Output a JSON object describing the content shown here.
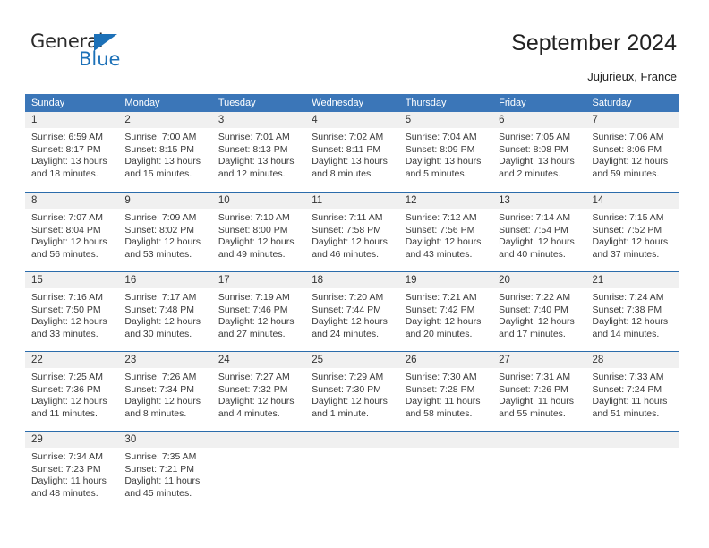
{
  "logo": {
    "word1": "General",
    "word2": "Blue",
    "triangle_color": "#1d71b8"
  },
  "header": {
    "title": "September 2024",
    "subtitle": "Jujurieux, France"
  },
  "theme": {
    "header_blue": "#3b76b8",
    "separator_blue": "#2b6cab",
    "daynum_bg": "#f0f0f0"
  },
  "calendar": {
    "weekdays": [
      "Sunday",
      "Monday",
      "Tuesday",
      "Wednesday",
      "Thursday",
      "Friday",
      "Saturday"
    ],
    "weeks": [
      [
        {
          "day": "1",
          "sunrise": "Sunrise: 6:59 AM",
          "sunset": "Sunset: 8:17 PM",
          "daylight1": "Daylight: 13 hours",
          "daylight2": "and 18 minutes."
        },
        {
          "day": "2",
          "sunrise": "Sunrise: 7:00 AM",
          "sunset": "Sunset: 8:15 PM",
          "daylight1": "Daylight: 13 hours",
          "daylight2": "and 15 minutes."
        },
        {
          "day": "3",
          "sunrise": "Sunrise: 7:01 AM",
          "sunset": "Sunset: 8:13 PM",
          "daylight1": "Daylight: 13 hours",
          "daylight2": "and 12 minutes."
        },
        {
          "day": "4",
          "sunrise": "Sunrise: 7:02 AM",
          "sunset": "Sunset: 8:11 PM",
          "daylight1": "Daylight: 13 hours",
          "daylight2": "and 8 minutes."
        },
        {
          "day": "5",
          "sunrise": "Sunrise: 7:04 AM",
          "sunset": "Sunset: 8:09 PM",
          "daylight1": "Daylight: 13 hours",
          "daylight2": "and 5 minutes."
        },
        {
          "day": "6",
          "sunrise": "Sunrise: 7:05 AM",
          "sunset": "Sunset: 8:08 PM",
          "daylight1": "Daylight: 13 hours",
          "daylight2": "and 2 minutes."
        },
        {
          "day": "7",
          "sunrise": "Sunrise: 7:06 AM",
          "sunset": "Sunset: 8:06 PM",
          "daylight1": "Daylight: 12 hours",
          "daylight2": "and 59 minutes."
        }
      ],
      [
        {
          "day": "8",
          "sunrise": "Sunrise: 7:07 AM",
          "sunset": "Sunset: 8:04 PM",
          "daylight1": "Daylight: 12 hours",
          "daylight2": "and 56 minutes."
        },
        {
          "day": "9",
          "sunrise": "Sunrise: 7:09 AM",
          "sunset": "Sunset: 8:02 PM",
          "daylight1": "Daylight: 12 hours",
          "daylight2": "and 53 minutes."
        },
        {
          "day": "10",
          "sunrise": "Sunrise: 7:10 AM",
          "sunset": "Sunset: 8:00 PM",
          "daylight1": "Daylight: 12 hours",
          "daylight2": "and 49 minutes."
        },
        {
          "day": "11",
          "sunrise": "Sunrise: 7:11 AM",
          "sunset": "Sunset: 7:58 PM",
          "daylight1": "Daylight: 12 hours",
          "daylight2": "and 46 minutes."
        },
        {
          "day": "12",
          "sunrise": "Sunrise: 7:12 AM",
          "sunset": "Sunset: 7:56 PM",
          "daylight1": "Daylight: 12 hours",
          "daylight2": "and 43 minutes."
        },
        {
          "day": "13",
          "sunrise": "Sunrise: 7:14 AM",
          "sunset": "Sunset: 7:54 PM",
          "daylight1": "Daylight: 12 hours",
          "daylight2": "and 40 minutes."
        },
        {
          "day": "14",
          "sunrise": "Sunrise: 7:15 AM",
          "sunset": "Sunset: 7:52 PM",
          "daylight1": "Daylight: 12 hours",
          "daylight2": "and 37 minutes."
        }
      ],
      [
        {
          "day": "15",
          "sunrise": "Sunrise: 7:16 AM",
          "sunset": "Sunset: 7:50 PM",
          "daylight1": "Daylight: 12 hours",
          "daylight2": "and 33 minutes."
        },
        {
          "day": "16",
          "sunrise": "Sunrise: 7:17 AM",
          "sunset": "Sunset: 7:48 PM",
          "daylight1": "Daylight: 12 hours",
          "daylight2": "and 30 minutes."
        },
        {
          "day": "17",
          "sunrise": "Sunrise: 7:19 AM",
          "sunset": "Sunset: 7:46 PM",
          "daylight1": "Daylight: 12 hours",
          "daylight2": "and 27 minutes."
        },
        {
          "day": "18",
          "sunrise": "Sunrise: 7:20 AM",
          "sunset": "Sunset: 7:44 PM",
          "daylight1": "Daylight: 12 hours",
          "daylight2": "and 24 minutes."
        },
        {
          "day": "19",
          "sunrise": "Sunrise: 7:21 AM",
          "sunset": "Sunset: 7:42 PM",
          "daylight1": "Daylight: 12 hours",
          "daylight2": "and 20 minutes."
        },
        {
          "day": "20",
          "sunrise": "Sunrise: 7:22 AM",
          "sunset": "Sunset: 7:40 PM",
          "daylight1": "Daylight: 12 hours",
          "daylight2": "and 17 minutes."
        },
        {
          "day": "21",
          "sunrise": "Sunrise: 7:24 AM",
          "sunset": "Sunset: 7:38 PM",
          "daylight1": "Daylight: 12 hours",
          "daylight2": "and 14 minutes."
        }
      ],
      [
        {
          "day": "22",
          "sunrise": "Sunrise: 7:25 AM",
          "sunset": "Sunset: 7:36 PM",
          "daylight1": "Daylight: 12 hours",
          "daylight2": "and 11 minutes."
        },
        {
          "day": "23",
          "sunrise": "Sunrise: 7:26 AM",
          "sunset": "Sunset: 7:34 PM",
          "daylight1": "Daylight: 12 hours",
          "daylight2": "and 8 minutes."
        },
        {
          "day": "24",
          "sunrise": "Sunrise: 7:27 AM",
          "sunset": "Sunset: 7:32 PM",
          "daylight1": "Daylight: 12 hours",
          "daylight2": "and 4 minutes."
        },
        {
          "day": "25",
          "sunrise": "Sunrise: 7:29 AM",
          "sunset": "Sunset: 7:30 PM",
          "daylight1": "Daylight: 12 hours",
          "daylight2": "and 1 minute."
        },
        {
          "day": "26",
          "sunrise": "Sunrise: 7:30 AM",
          "sunset": "Sunset: 7:28 PM",
          "daylight1": "Daylight: 11 hours",
          "daylight2": "and 58 minutes."
        },
        {
          "day": "27",
          "sunrise": "Sunrise: 7:31 AM",
          "sunset": "Sunset: 7:26 PM",
          "daylight1": "Daylight: 11 hours",
          "daylight2": "and 55 minutes."
        },
        {
          "day": "28",
          "sunrise": "Sunrise: 7:33 AM",
          "sunset": "Sunset: 7:24 PM",
          "daylight1": "Daylight: 11 hours",
          "daylight2": "and 51 minutes."
        }
      ],
      [
        {
          "day": "29",
          "sunrise": "Sunrise: 7:34 AM",
          "sunset": "Sunset: 7:23 PM",
          "daylight1": "Daylight: 11 hours",
          "daylight2": "and 48 minutes."
        },
        {
          "day": "30",
          "sunrise": "Sunrise: 7:35 AM",
          "sunset": "Sunset: 7:21 PM",
          "daylight1": "Daylight: 11 hours",
          "daylight2": "and 45 minutes."
        },
        {
          "day": "",
          "sunrise": "",
          "sunset": "",
          "daylight1": "",
          "daylight2": ""
        },
        {
          "day": "",
          "sunrise": "",
          "sunset": "",
          "daylight1": "",
          "daylight2": ""
        },
        {
          "day": "",
          "sunrise": "",
          "sunset": "",
          "daylight1": "",
          "daylight2": ""
        },
        {
          "day": "",
          "sunrise": "",
          "sunset": "",
          "daylight1": "",
          "daylight2": ""
        },
        {
          "day": "",
          "sunrise": "",
          "sunset": "",
          "daylight1": "",
          "daylight2": ""
        }
      ]
    ]
  }
}
